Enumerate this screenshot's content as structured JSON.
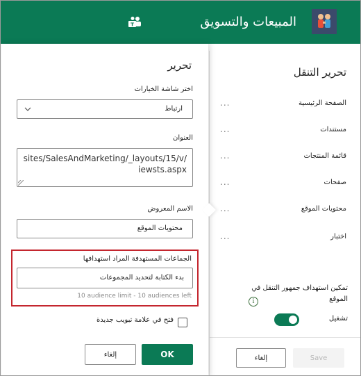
{
  "header": {
    "title": "المبيعات والتسويق",
    "logo_icon": "site-logo-people-icon",
    "teams_icon": "teams-icon",
    "background": "#0b7a55"
  },
  "nav_panel": {
    "title": "تحرير التنقل",
    "items": [
      {
        "label": "الصفحة الرئيسية",
        "more": "..."
      },
      {
        "label": "مستندات",
        "more": "..."
      },
      {
        "label": "قائمة المنتجات",
        "more": "..."
      },
      {
        "label": "صفحات",
        "more": "..."
      },
      {
        "label": "محتويات الموقع",
        "more": "..."
      },
      {
        "label": "اختبار",
        "more": "..."
      }
    ],
    "audience_targeting_text": "تمكين استهداف جمهور التنقل في الموقع",
    "info_symbol": "i",
    "toggle_label": "تشغيل",
    "toggle_on": true,
    "cancel_label": "إلغاء",
    "save_label": "Save"
  },
  "edit_panel": {
    "title": "تحرير",
    "choose_option_label": "اختر شاشة الخيارات",
    "choose_option_value": "ارتباط",
    "address_label": "العنوان",
    "address_value": "/sites/SalesAndMarketing/_layouts/15/viewsts.aspx",
    "display_name_label": "الاسم المعروض",
    "display_name_value": "محتويات الموقع",
    "audience_label": "الجماعات المستهدفة المراد استهدافها",
    "audience_placeholder": "بدء الكتابة لتحديد المجموعات",
    "audience_limit": "10 audience limit - 10 audiences left",
    "new_tab_label": "فتح في علامة تبويب جديدة",
    "new_tab_checked": false,
    "ok_label": "OK",
    "cancel_label": "إلغاء"
  },
  "colors": {
    "accent": "#0b7a55",
    "highlight_border": "#c4262e"
  }
}
